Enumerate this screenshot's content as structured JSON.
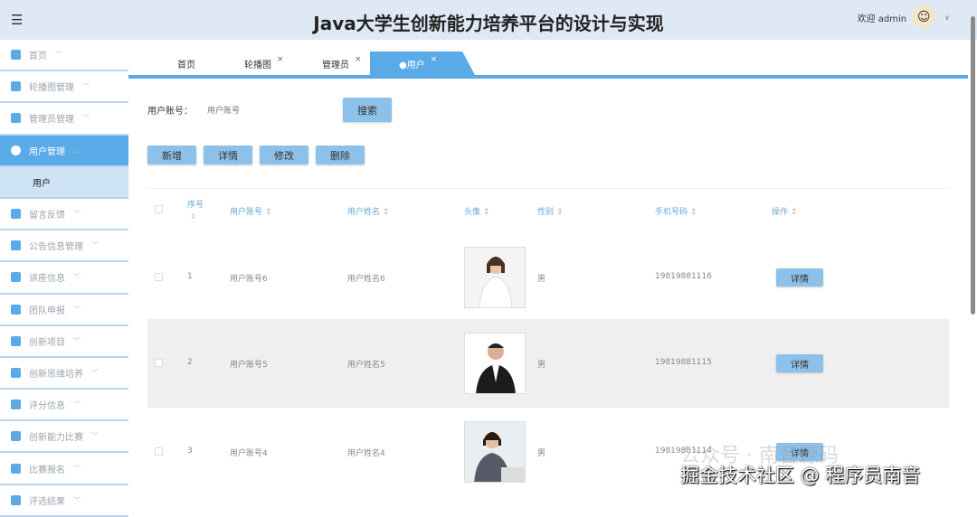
{
  "header": {
    "title": "Java大学生创新能力培养平台的设计与实现",
    "welcome": "欢迎 admin"
  },
  "sidebar": {
    "items": [
      {
        "label": "首页"
      },
      {
        "label": "轮播图管理"
      },
      {
        "label": "管理员管理"
      },
      {
        "label": "用户管理",
        "active": true
      },
      {
        "label": "用户",
        "sub": true
      },
      {
        "label": "留言反馈"
      },
      {
        "label": "公告信息管理"
      },
      {
        "label": "讲座信息"
      },
      {
        "label": "团队申报"
      },
      {
        "label": "创新项目"
      },
      {
        "label": "创新思维培养"
      },
      {
        "label": "评分信息"
      },
      {
        "label": "创新能力比赛"
      },
      {
        "label": "比赛报名"
      },
      {
        "label": "评选结果"
      }
    ]
  },
  "tabs": [
    {
      "label": "首页"
    },
    {
      "label": "轮播图",
      "close": "×"
    },
    {
      "label": "管理员",
      "close": "×"
    },
    {
      "label": "●用户",
      "close": "×"
    }
  ],
  "search": {
    "label": "用户账号：",
    "placeholder": "用户账号",
    "button": "搜索"
  },
  "actions": {
    "add": "新增",
    "detail": "详情",
    "edit": "修改",
    "delete": "删除"
  },
  "table": {
    "headers": {
      "index": "序号",
      "account": "用户账号",
      "name": "用户姓名",
      "avatar": "头像",
      "gender": "性别",
      "phone": "手机号码",
      "ops": "操作"
    },
    "rows": [
      {
        "index": "1",
        "account": "用户账号6",
        "name": "用户姓名6",
        "gender": "男",
        "phone": "19819881116",
        "op": "详情"
      },
      {
        "index": "2",
        "account": "用户账号5",
        "name": "用户姓名5",
        "gender": "男",
        "phone": "19819881115",
        "op": "详情"
      },
      {
        "index": "3",
        "account": "用户账号4",
        "name": "用户姓名4",
        "gender": "男",
        "phone": "19819881114",
        "op": "详情"
      }
    ]
  },
  "watermark": {
    "line1": "公众号 · 南音源码",
    "line2": "掘金技术社区 @ 程序员南音"
  }
}
